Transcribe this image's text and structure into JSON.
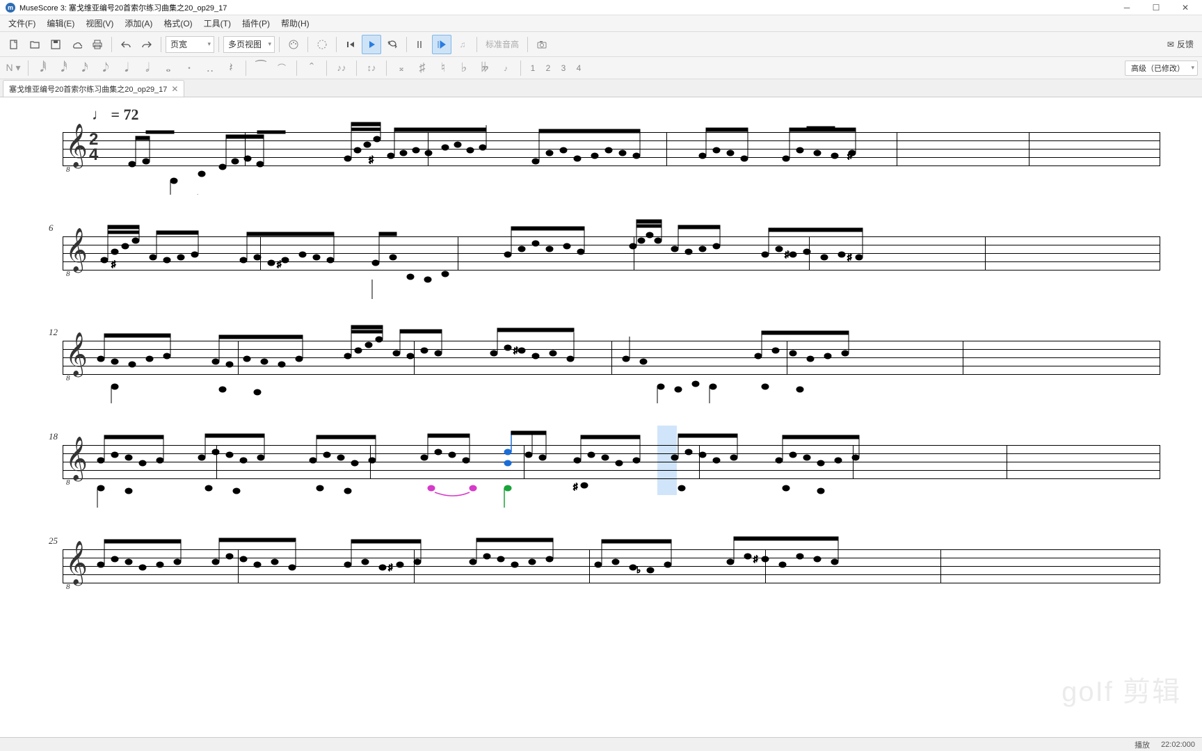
{
  "window": {
    "app": "MuseScore 3",
    "title": "MuseScore 3: 塞戈维亚编号20首索尔练习曲集之20_op29_17",
    "icon_letter": "m"
  },
  "menu": [
    "文件(F)",
    "编辑(E)",
    "视图(V)",
    "添加(A)",
    "格式(O)",
    "工具(T)",
    "插件(P)",
    "帮助(H)"
  ],
  "toolbar": {
    "view_mode": "页宽",
    "layout_mode": "多页视图",
    "concert_pitch": "标准音高",
    "feedback": "反馈"
  },
  "note_toolbar": {
    "voices": [
      "1",
      "2",
      "3",
      "4"
    ],
    "workspace": "高级（已修改）"
  },
  "tab": {
    "label": "塞戈维亚编号20首索尔练习曲集之20_op29_17"
  },
  "score": {
    "tempo": "♩ = 72",
    "time_sig_top": "2",
    "time_sig_bot": "4",
    "system_measure_nums": [
      "",
      "6",
      "12",
      "18",
      "25"
    ]
  },
  "status": {
    "mode": "播放",
    "time": "22:02:000"
  },
  "watermark": "goIf 剪辑"
}
